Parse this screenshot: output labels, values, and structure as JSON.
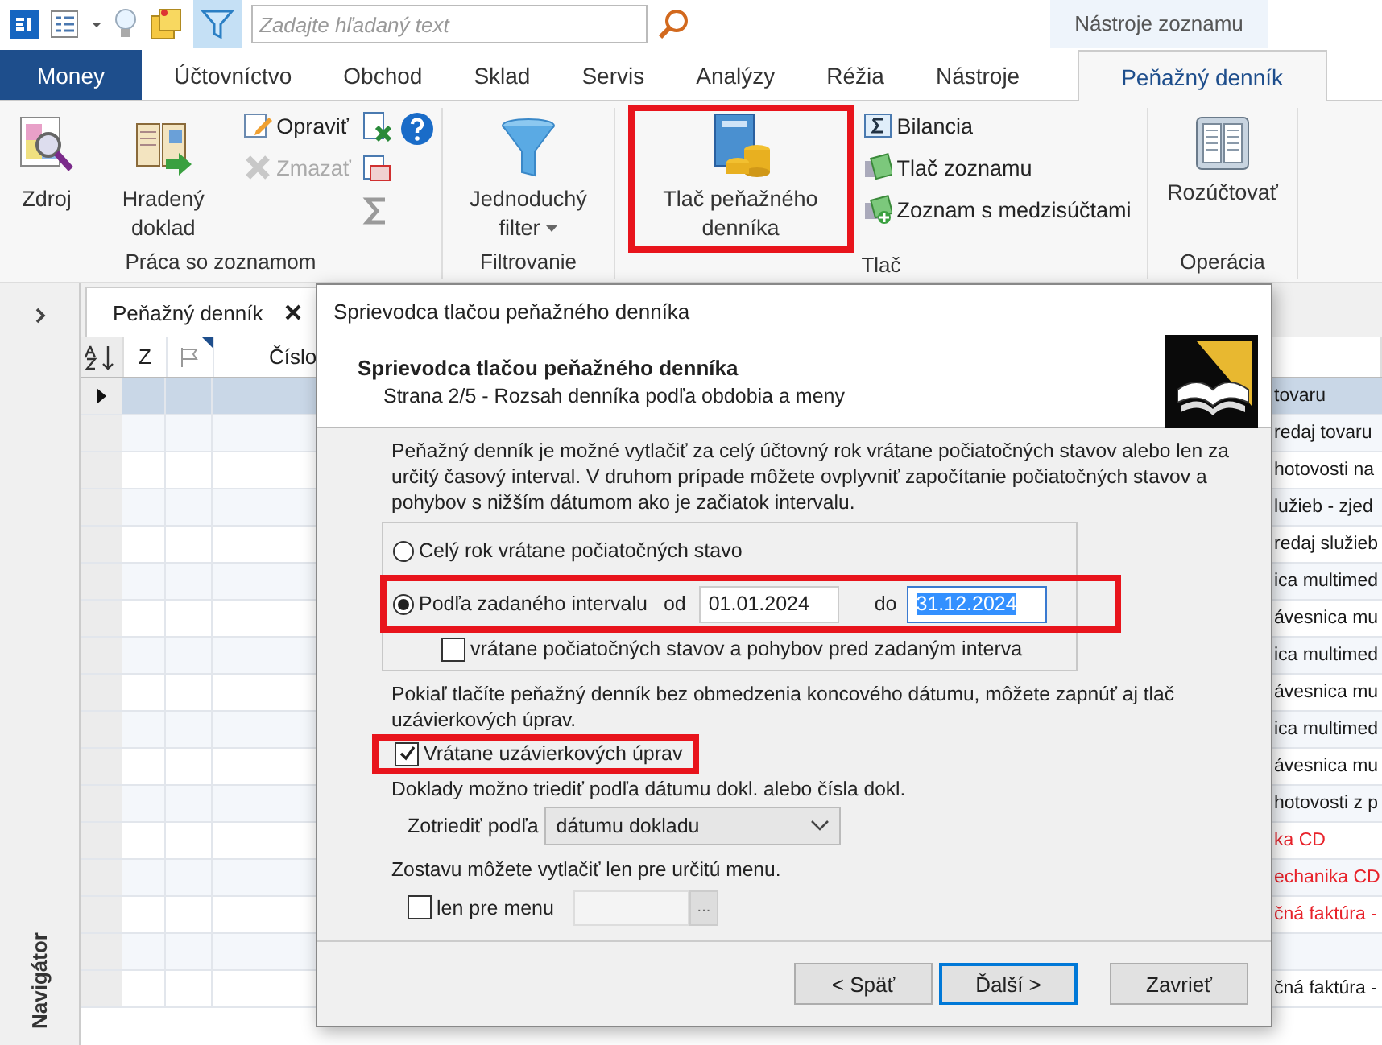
{
  "quick_access": {
    "search": {
      "placeholder": "Zadajte hľadaný text"
    }
  },
  "context_group": "Nástroje zoznamu",
  "tabs": [
    {
      "label": "Money",
      "kind": "app",
      "selected": false
    },
    {
      "label": "Účtovníctvo",
      "kind": "normal",
      "selected": false
    },
    {
      "label": "Obchod",
      "kind": "normal",
      "selected": false
    },
    {
      "label": "Sklad",
      "kind": "normal",
      "selected": false
    },
    {
      "label": "Servis",
      "kind": "normal",
      "selected": false
    },
    {
      "label": "Analýzy",
      "kind": "normal",
      "selected": false
    },
    {
      "label": "Réžia",
      "kind": "normal",
      "selected": false
    },
    {
      "label": "Nástroje",
      "kind": "normal",
      "selected": false
    },
    {
      "label": "Peňažný denník",
      "kind": "context",
      "selected": true
    }
  ],
  "ribbon": {
    "groups": [
      {
        "label": "Práca so zoznamom",
        "large": [
          {
            "label": "Zdroj",
            "dropdown": false,
            "highlighted": false
          },
          {
            "label": "Hradený doklad",
            "dropdown": false,
            "highlighted": false
          }
        ],
        "small": [
          {
            "label": "Opraviť",
            "disabled": false
          },
          {
            "label": "Zmazať",
            "disabled": true
          }
        ]
      },
      {
        "label": "Filtrovanie",
        "large": [
          {
            "label": "Jednoduchý filter",
            "dropdown": true,
            "highlighted": false
          }
        ]
      },
      {
        "label": "Tlač",
        "large": [
          {
            "label": "Tlač peňažného denníka",
            "dropdown": false,
            "highlighted": true
          }
        ],
        "small": [
          {
            "label": "Bilancia",
            "disabled": false
          },
          {
            "label": "Tlač zoznamu",
            "disabled": false
          },
          {
            "label": "Zoznam s medzisúčtami",
            "disabled": false
          }
        ]
      },
      {
        "label": "Operácia",
        "large": [
          {
            "label": "Rozúčtovať",
            "dropdown": false,
            "highlighted": false
          }
        ]
      }
    ]
  },
  "navigator": {
    "label": "Navigátor"
  },
  "document_tab": {
    "label": "Peňažný denník"
  },
  "grid": {
    "columns": [
      "Z",
      "Číslo"
    ],
    "rows": [
      {
        "text": "tovaru",
        "color": "#1a1a1a",
        "selected": true
      },
      {
        "text": "redaj tovaru",
        "color": "#1a1a1a",
        "selected": false
      },
      {
        "text": "hotovosti na",
        "color": "#1a1a1a",
        "selected": false
      },
      {
        "text": "lužieb - zjed",
        "color": "#1a1a1a",
        "selected": false
      },
      {
        "text": "redaj služieb",
        "color": "#1a1a1a",
        "selected": false
      },
      {
        "text": "ica multimed",
        "color": "#1a1a1a",
        "selected": false
      },
      {
        "text": "ávesnica mu",
        "color": "#1a1a1a",
        "selected": false
      },
      {
        "text": "ica multimed",
        "color": "#1a1a1a",
        "selected": false
      },
      {
        "text": "ávesnica mu",
        "color": "#1a1a1a",
        "selected": false
      },
      {
        "text": "ica multimed",
        "color": "#1a1a1a",
        "selected": false
      },
      {
        "text": "ávesnica mu",
        "color": "#1a1a1a",
        "selected": false
      },
      {
        "text": "hotovosti z p",
        "color": "#1a1a1a",
        "selected": false
      },
      {
        "text": "ka CD",
        "color": "#e8222a",
        "selected": false
      },
      {
        "text": "echanika CD",
        "color": "#e8222a",
        "selected": false
      },
      {
        "text": "čná faktúra -",
        "color": "#e8222a",
        "selected": false
      },
      {
        "selected": false
      },
      {
        "text": "čná faktúra -",
        "color": "#1a1a1a",
        "selected": false
      }
    ]
  },
  "dialog": {
    "title": "Sprievodca tlačou peňažného denníka",
    "heading": "Sprievodca tlačou peňažného denníka",
    "subtitle": "Strana 2/5 - Rozsah denníka podľa obdobia a meny",
    "intro": "Peňažný denník je možné vytlačiť za celý účtovný rok vrátane počiatočných stavov alebo len za určitý časový interval. V druhom prípade môžete ovplyvniť započítanie počiatočných stavov a pohybov s nižším dátumom ako je začiatok intervalu.",
    "range_options": [
      {
        "label": "Celý rok vrátane počiatočných stavo",
        "kind": "plain",
        "selected": false,
        "highlighted": false
      },
      {
        "label": "Podľa zadaného intervalu",
        "kind": "interval",
        "selected": true,
        "highlighted": true
      }
    ],
    "from_label": "od",
    "from_value": "01.01.2024",
    "to_label": "do",
    "to_value": "31.12.2024",
    "to_value_selected": true,
    "initial_states": {
      "label": "vrátane počiatočných stavov a pohybov pred zadaným interva",
      "checked": false
    },
    "closing_note": "Pokiaľ tlačíte peňažný denník bez obmedzenia koncového dátumu, môžete zapnúť aj tlač uzávierkových úprav.",
    "closing": {
      "label": "Vrátane uzávierkových úprav",
      "checked": true,
      "highlighted": true
    },
    "sort_note": "Doklady možno triediť podľa dátumu dokl. alebo čísla dokl.",
    "sort_label": "Zotriediť podľa",
    "sort_value": "dátumu dokladu",
    "currency_note": "Zostavu môžete vytlačiť len pre určitú menu.",
    "currency": {
      "label": "len pre menu",
      "checked": false,
      "browse": "..."
    },
    "buttons": [
      {
        "label": "< Späť",
        "selected": false
      },
      {
        "label": "Ďalší >",
        "selected": true
      },
      {
        "label": "Zavrieť",
        "selected": false
      }
    ]
  }
}
